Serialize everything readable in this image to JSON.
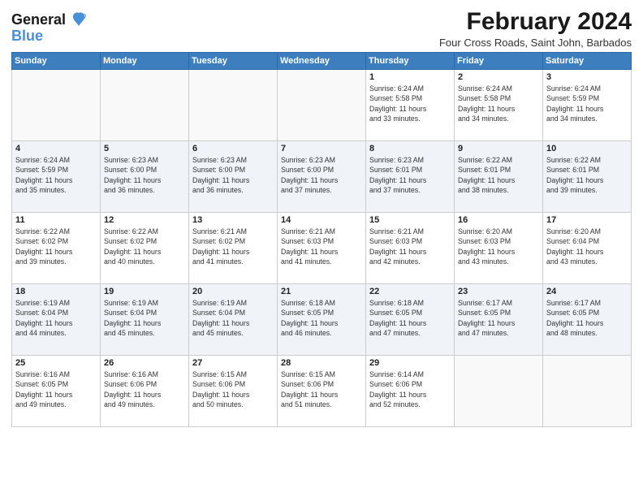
{
  "app": {
    "logo_line1": "General",
    "logo_line2": "Blue"
  },
  "header": {
    "month_year": "February 2024",
    "location": "Four Cross Roads, Saint John, Barbados"
  },
  "weekdays": [
    "Sunday",
    "Monday",
    "Tuesday",
    "Wednesday",
    "Thursday",
    "Friday",
    "Saturday"
  ],
  "weeks": [
    [
      {
        "day": "",
        "info": ""
      },
      {
        "day": "",
        "info": ""
      },
      {
        "day": "",
        "info": ""
      },
      {
        "day": "",
        "info": ""
      },
      {
        "day": "1",
        "info": "Sunrise: 6:24 AM\nSunset: 5:58 PM\nDaylight: 11 hours\nand 33 minutes."
      },
      {
        "day": "2",
        "info": "Sunrise: 6:24 AM\nSunset: 5:58 PM\nDaylight: 11 hours\nand 34 minutes."
      },
      {
        "day": "3",
        "info": "Sunrise: 6:24 AM\nSunset: 5:59 PM\nDaylight: 11 hours\nand 34 minutes."
      }
    ],
    [
      {
        "day": "4",
        "info": "Sunrise: 6:24 AM\nSunset: 5:59 PM\nDaylight: 11 hours\nand 35 minutes."
      },
      {
        "day": "5",
        "info": "Sunrise: 6:23 AM\nSunset: 6:00 PM\nDaylight: 11 hours\nand 36 minutes."
      },
      {
        "day": "6",
        "info": "Sunrise: 6:23 AM\nSunset: 6:00 PM\nDaylight: 11 hours\nand 36 minutes."
      },
      {
        "day": "7",
        "info": "Sunrise: 6:23 AM\nSunset: 6:00 PM\nDaylight: 11 hours\nand 37 minutes."
      },
      {
        "day": "8",
        "info": "Sunrise: 6:23 AM\nSunset: 6:01 PM\nDaylight: 11 hours\nand 37 minutes."
      },
      {
        "day": "9",
        "info": "Sunrise: 6:22 AM\nSunset: 6:01 PM\nDaylight: 11 hours\nand 38 minutes."
      },
      {
        "day": "10",
        "info": "Sunrise: 6:22 AM\nSunset: 6:01 PM\nDaylight: 11 hours\nand 39 minutes."
      }
    ],
    [
      {
        "day": "11",
        "info": "Sunrise: 6:22 AM\nSunset: 6:02 PM\nDaylight: 11 hours\nand 39 minutes."
      },
      {
        "day": "12",
        "info": "Sunrise: 6:22 AM\nSunset: 6:02 PM\nDaylight: 11 hours\nand 40 minutes."
      },
      {
        "day": "13",
        "info": "Sunrise: 6:21 AM\nSunset: 6:02 PM\nDaylight: 11 hours\nand 41 minutes."
      },
      {
        "day": "14",
        "info": "Sunrise: 6:21 AM\nSunset: 6:03 PM\nDaylight: 11 hours\nand 41 minutes."
      },
      {
        "day": "15",
        "info": "Sunrise: 6:21 AM\nSunset: 6:03 PM\nDaylight: 11 hours\nand 42 minutes."
      },
      {
        "day": "16",
        "info": "Sunrise: 6:20 AM\nSunset: 6:03 PM\nDaylight: 11 hours\nand 43 minutes."
      },
      {
        "day": "17",
        "info": "Sunrise: 6:20 AM\nSunset: 6:04 PM\nDaylight: 11 hours\nand 43 minutes."
      }
    ],
    [
      {
        "day": "18",
        "info": "Sunrise: 6:19 AM\nSunset: 6:04 PM\nDaylight: 11 hours\nand 44 minutes."
      },
      {
        "day": "19",
        "info": "Sunrise: 6:19 AM\nSunset: 6:04 PM\nDaylight: 11 hours\nand 45 minutes."
      },
      {
        "day": "20",
        "info": "Sunrise: 6:19 AM\nSunset: 6:04 PM\nDaylight: 11 hours\nand 45 minutes."
      },
      {
        "day": "21",
        "info": "Sunrise: 6:18 AM\nSunset: 6:05 PM\nDaylight: 11 hours\nand 46 minutes."
      },
      {
        "day": "22",
        "info": "Sunrise: 6:18 AM\nSunset: 6:05 PM\nDaylight: 11 hours\nand 47 minutes."
      },
      {
        "day": "23",
        "info": "Sunrise: 6:17 AM\nSunset: 6:05 PM\nDaylight: 11 hours\nand 47 minutes."
      },
      {
        "day": "24",
        "info": "Sunrise: 6:17 AM\nSunset: 6:05 PM\nDaylight: 11 hours\nand 48 minutes."
      }
    ],
    [
      {
        "day": "25",
        "info": "Sunrise: 6:16 AM\nSunset: 6:05 PM\nDaylight: 11 hours\nand 49 minutes."
      },
      {
        "day": "26",
        "info": "Sunrise: 6:16 AM\nSunset: 6:06 PM\nDaylight: 11 hours\nand 49 minutes."
      },
      {
        "day": "27",
        "info": "Sunrise: 6:15 AM\nSunset: 6:06 PM\nDaylight: 11 hours\nand 50 minutes."
      },
      {
        "day": "28",
        "info": "Sunrise: 6:15 AM\nSunset: 6:06 PM\nDaylight: 11 hours\nand 51 minutes."
      },
      {
        "day": "29",
        "info": "Sunrise: 6:14 AM\nSunset: 6:06 PM\nDaylight: 11 hours\nand 52 minutes."
      },
      {
        "day": "",
        "info": ""
      },
      {
        "day": "",
        "info": ""
      }
    ]
  ]
}
